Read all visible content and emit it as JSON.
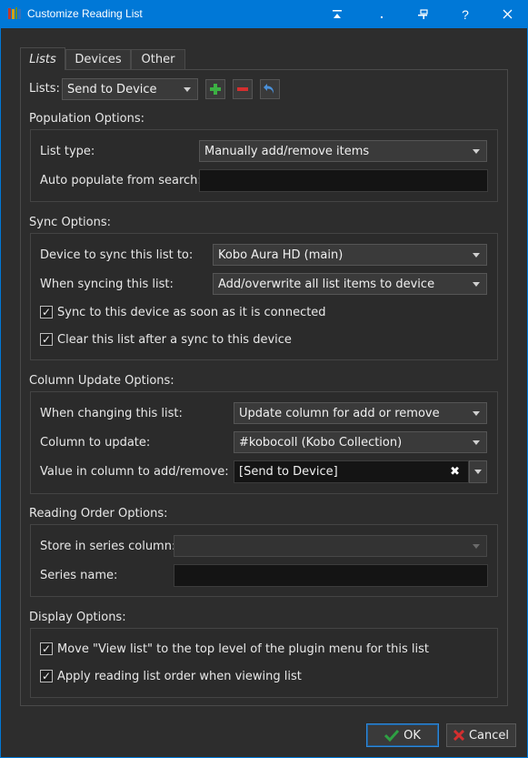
{
  "window": {
    "title": "Customize Reading List",
    "accent": "#0078d7",
    "controls": [
      "▲",
      "ˑ",
      "⭲",
      "?",
      "✕"
    ]
  },
  "tabs": [
    {
      "label": "Lists",
      "active": true
    },
    {
      "label": "Devices",
      "active": false
    },
    {
      "label": "Other",
      "active": false
    }
  ],
  "lists": {
    "label": "Lists:",
    "selected": "Send to Device",
    "add_icon": "plus-icon",
    "remove_icon": "minus-icon",
    "rename_icon": "undo-arrow-icon"
  },
  "population": {
    "heading": "Population Options:",
    "list_type_label": "List type:",
    "list_type_value": "Manually add/remove items",
    "auto_populate_label": "Auto populate from search:",
    "auto_populate_value": ""
  },
  "sync": {
    "heading": "Sync Options:",
    "device_label": "Device to sync this list to:",
    "device_value": "Kobo Aura HD (main)",
    "when_label": "When syncing this list:",
    "when_value": "Add/overwrite all list items to device",
    "chk1_label": "Sync to this device as soon as it is connected",
    "chk1_checked": true,
    "chk2_label": "Clear this list after a sync to this device",
    "chk2_checked": true
  },
  "column": {
    "heading": "Column Update Options:",
    "changing_label": "When changing this list:",
    "changing_value": "Update column for add or remove",
    "column_label": "Column to update:",
    "column_value": "#kobocoll (Kobo Collection)",
    "value_label": "Value in column to add/remove:",
    "value_value": "[Send to Device]"
  },
  "reading_order": {
    "heading": "Reading Order Options:",
    "series_col_label": "Store in series column:",
    "series_col_value": "",
    "series_name_label": "Series name:",
    "series_name_value": ""
  },
  "display": {
    "heading": "Display Options:",
    "chk1_label": "Move \"View list\" to the top level of the plugin menu for this list",
    "chk1_checked": true,
    "chk2_label": "Apply reading list order when viewing list",
    "chk2_checked": true
  },
  "buttons": {
    "ok": "OK",
    "cancel": "Cancel",
    "ok_color": "#2ea043",
    "cancel_color": "#d32f2f"
  },
  "check_glyph": "✓"
}
